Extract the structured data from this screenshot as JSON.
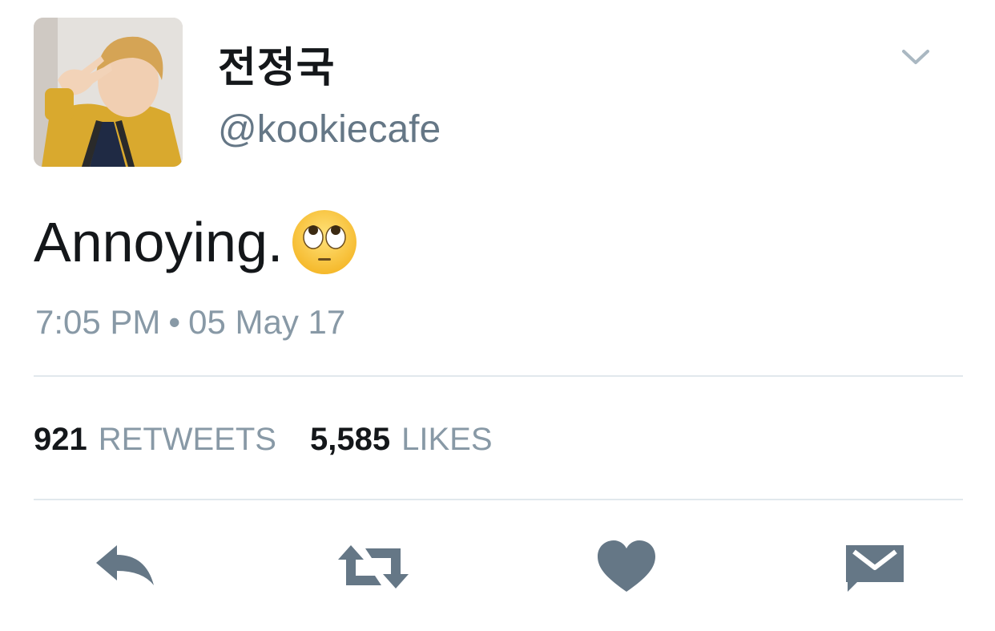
{
  "tweet": {
    "author": {
      "display_name": "전정국",
      "handle": "@kookiecafe",
      "avatar_icon": "profile-photo"
    },
    "text": "Annoying.",
    "emoji_icon": "face-with-rolling-eyes-emoji",
    "time": "7:05 PM",
    "separator": "•",
    "date": "05 May 17",
    "stats": {
      "retweets": {
        "count": "921",
        "label": "RETWEETS"
      },
      "likes": {
        "count": "5,585",
        "label": "LIKES"
      }
    },
    "actions": [
      "reply-icon",
      "retweet-icon",
      "like-icon",
      "direct-message-icon"
    ],
    "colors": {
      "primary_text": "#14171a",
      "secondary_text": "#657786",
      "muted_text": "#8899a6",
      "icon": "#657786",
      "divider": "#e1e8ed"
    }
  }
}
